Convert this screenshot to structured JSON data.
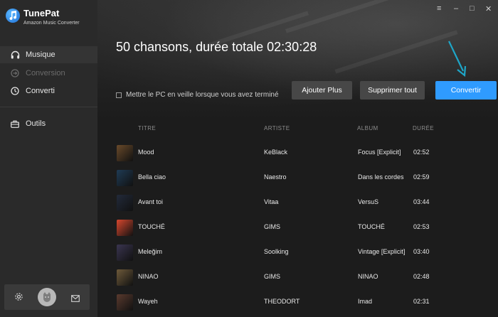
{
  "app": {
    "name": "TunePat",
    "subtitle": "Amazon Music Converter"
  },
  "sidebar": {
    "items": [
      {
        "label": "Musique",
        "icon": "headphones-icon",
        "active": true
      },
      {
        "label": "Conversion",
        "icon": "conversion-icon",
        "disabled": true
      },
      {
        "label": "Converti",
        "icon": "clock-icon"
      },
      {
        "label": "Outils",
        "icon": "toolbox-icon"
      }
    ],
    "bottom": {
      "settings_icon": "gear-icon",
      "avatar_icon": "avatar-icon",
      "mail_icon": "mail-icon"
    }
  },
  "window": {
    "menu": "≡",
    "minimize": "–",
    "maximize": "□",
    "close": "✕"
  },
  "header": {
    "summary": "50 chansons, durée totale 02:30:28",
    "sleep_checkbox_label": "Mettre le PC en veille lorsque vous avez terminé"
  },
  "toolbar": {
    "add_more": "Ajouter Plus",
    "delete_all": "Supprimer tout",
    "convert": "Convertir"
  },
  "table": {
    "headers": {
      "title": "TITRE",
      "artist": "ARTISTE",
      "album": "ALBUM",
      "duration": "DURÉE"
    },
    "rows": [
      {
        "title": "Mood",
        "artist": "KeBlack",
        "album": "Focus [Explicit]",
        "duration": "02:52",
        "cover": "#6a4a2a"
      },
      {
        "title": "Bella ciao",
        "artist": "Naestro",
        "album": "Dans les cordes",
        "duration": "02:59",
        "cover": "#1f3b55"
      },
      {
        "title": "Avant toi",
        "artist": "Vitaa",
        "album": "VersuS",
        "duration": "03:44",
        "cover": "#222a3a"
      },
      {
        "title": "TOUCHÉ",
        "artist": "GIMS",
        "album": "TOUCHÉ",
        "duration": "02:53",
        "cover": "#d8472e"
      },
      {
        "title": "Meleğim",
        "artist": "Soolking",
        "album": "Vintage [Explicit]",
        "duration": "03:40",
        "cover": "#3a3550"
      },
      {
        "title": "NINAO",
        "artist": "GIMS",
        "album": "NINAO",
        "duration": "02:48",
        "cover": "#6e5a3a"
      },
      {
        "title": "Wayeh",
        "artist": "THEODORT",
        "album": "Imad",
        "duration": "02:31",
        "cover": "#5a3a2e"
      }
    ]
  },
  "colors": {
    "accent": "#2f9bff",
    "sidebar_bg": "#2a2a2a",
    "main_bg": "#1c1c1c"
  }
}
